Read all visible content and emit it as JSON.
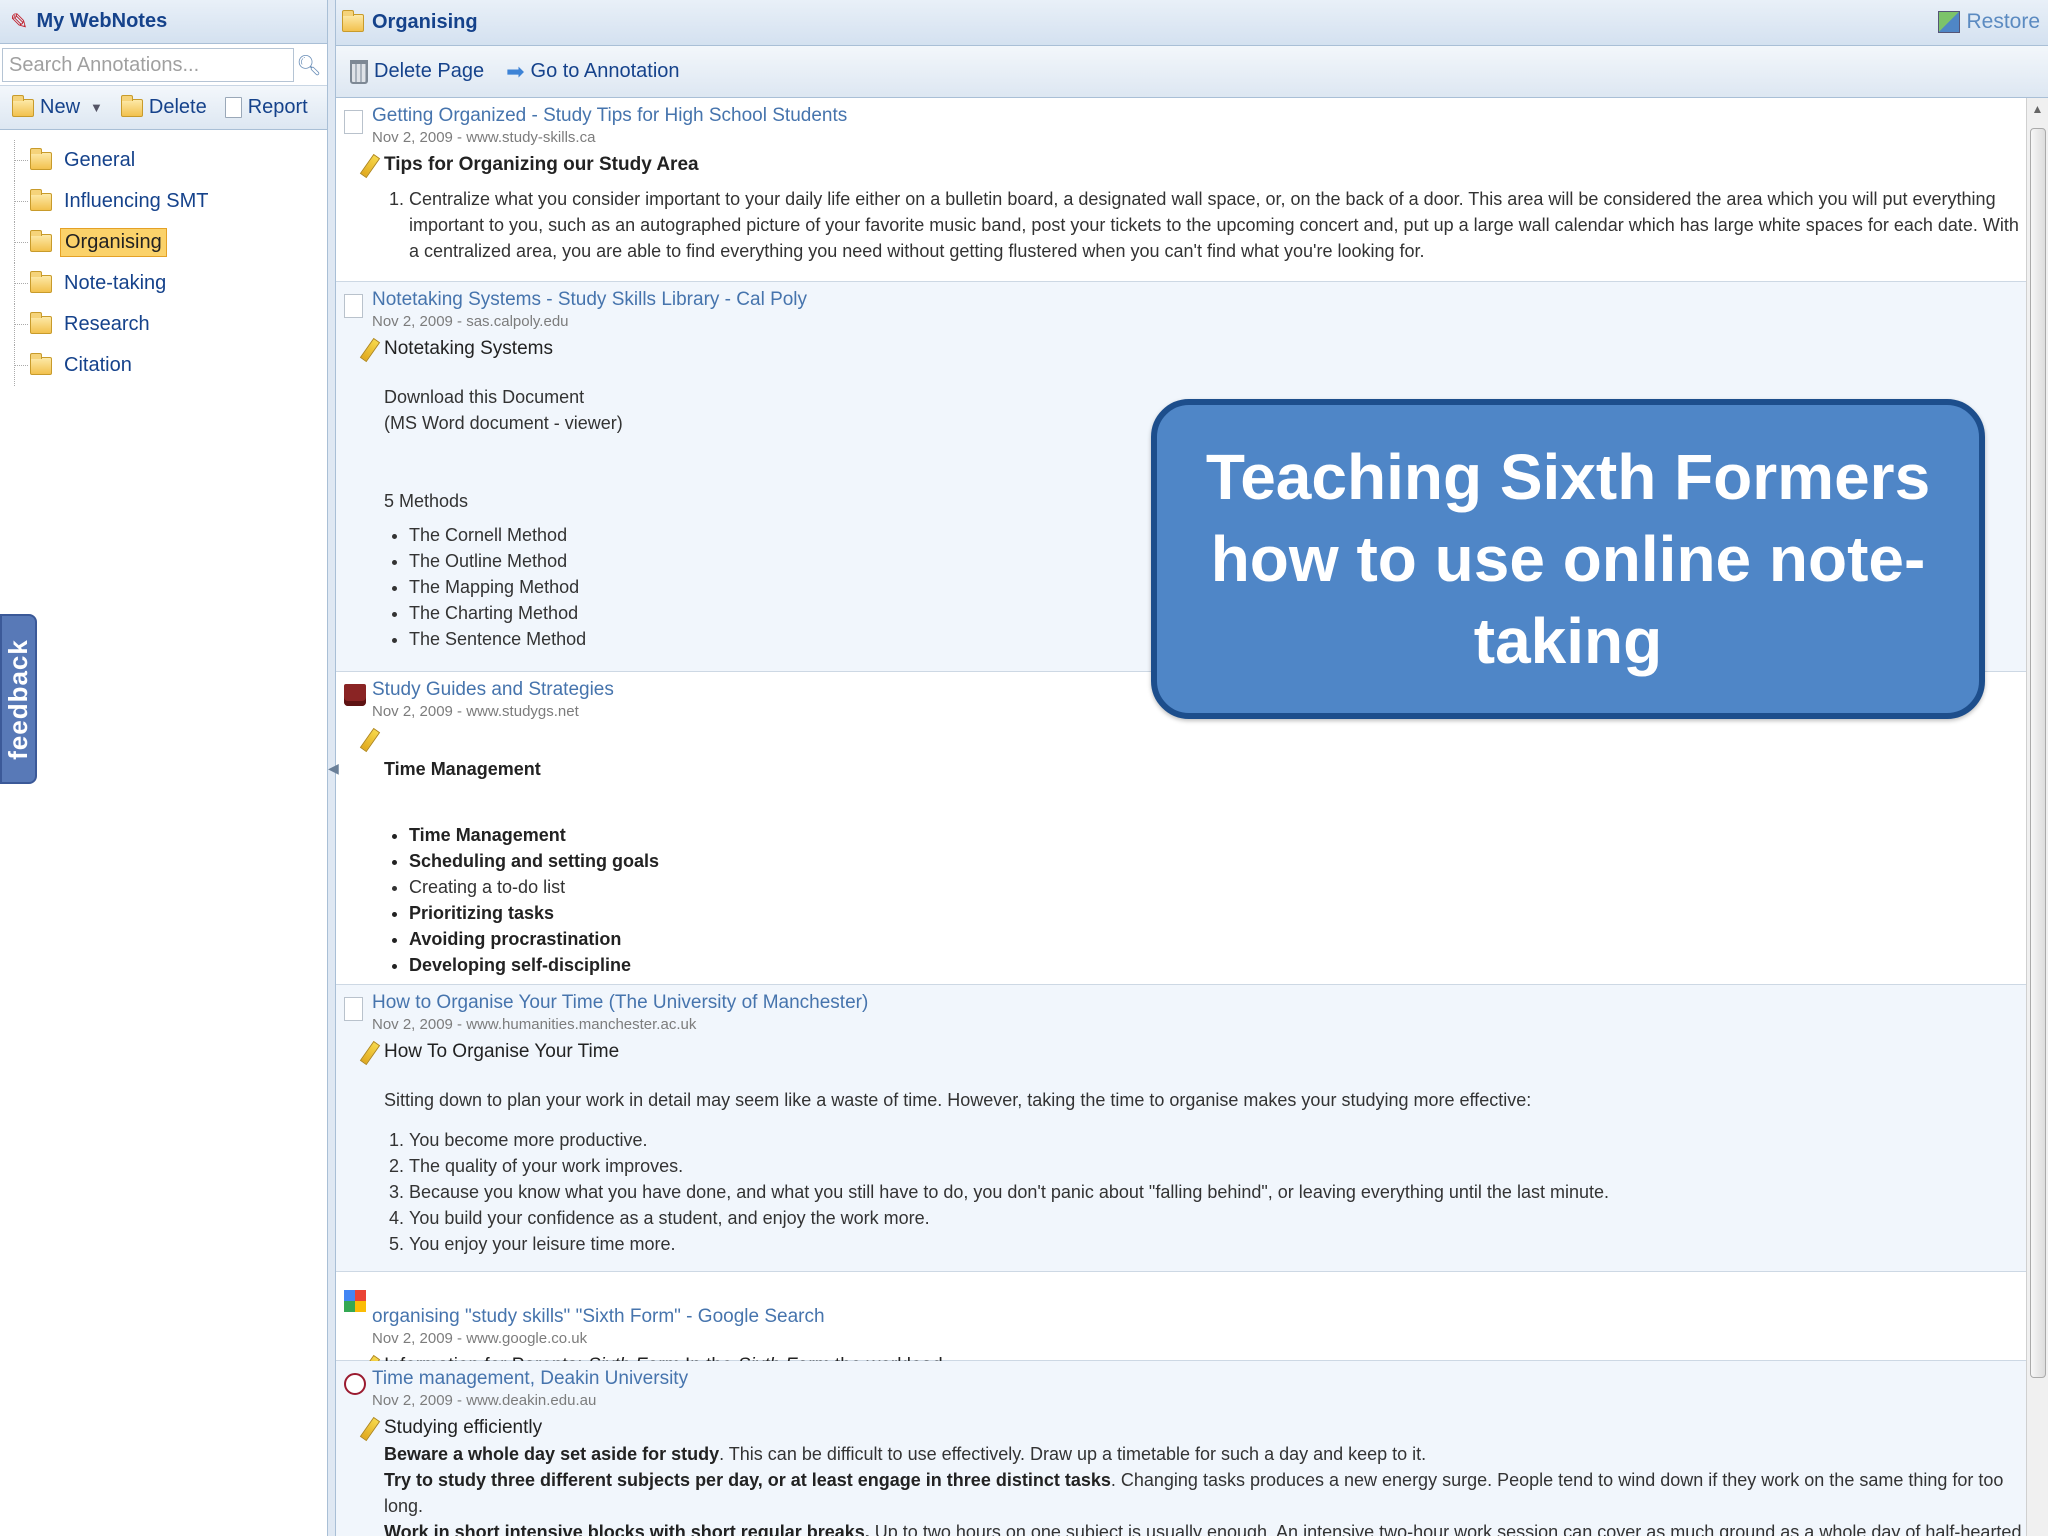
{
  "app": {
    "title": "My WebNotes",
    "search_placeholder": "Search Annotations...",
    "toolbar": {
      "new_label": "New",
      "delete_label": "Delete",
      "report_label": "Report"
    },
    "folders": [
      {
        "label": "General"
      },
      {
        "label": "Influencing SMT"
      },
      {
        "label": "Organising"
      },
      {
        "label": "Note-taking"
      },
      {
        "label": "Research"
      },
      {
        "label": "Citation"
      }
    ],
    "selected_folder": "Organising",
    "feedback_label": "feedback"
  },
  "main": {
    "folder_title": "Organising",
    "restore_label": "Restore",
    "toolbar": {
      "delete_page_label": "Delete Page",
      "go_to_annotation_label": "Go to Annotation"
    }
  },
  "entries": [
    {
      "title": "Getting Organized - Study Tips for High School Students",
      "meta": "Nov 2, 2009 - www.study-skills.ca",
      "annotation": "Tips for Organizing our Study Area",
      "ordered": [
        "Centralize what you consider important to your daily life either on a bulletin board, a designated wall space, or, on the back of a door.  This area will be considered the area which you will put everything important to you, such as an autographed picture of your favorite music band, post your tickets to the upcoming concert and, put up a large wall calendar which has large white spaces for each date.  With a centralized area, you are able to find everything you need without getting flustered when you can't find what you're looking for."
      ]
    },
    {
      "title": "Notetaking Systems - Study Skills Library - Cal Poly",
      "meta": "Nov 2, 2009 - sas.calpoly.edu",
      "annotation": "Notetaking Systems",
      "line1": "Download this Document",
      "line2": "(MS Word document - viewer)",
      "methods_heading": "5 Methods",
      "methods": [
        "The Cornell Method",
        "The Outline Method",
        "The Mapping Method",
        "The Charting Method",
        "The Sentence Method"
      ]
    },
    {
      "title": "Study Guides and Strategies",
      "meta": "Nov 2, 2009 - www.studygs.net",
      "heading": "Time Management",
      "items": [
        "Time Management",
        "Scheduling and setting goals",
        "Creating a to-do list",
        "Prioritizing tasks",
        "Avoiding procrastination",
        "Developing self-discipline"
      ]
    },
    {
      "title": "How to Organise Your Time (The University of Manchester)",
      "meta": "Nov 2, 2009 - www.humanities.manchester.ac.uk",
      "annotation": "How To Organise Your Time",
      "intro": "Sitting down to plan your work in detail may seem like a waste of time. However, taking the time to organise makes your studying more effective:",
      "ordered": [
        "You become more productive.",
        "The quality of your work improves.",
        "Because you know what you have done, and what you still have to do, you don't panic about \"falling behind\", or leaving everything until the last minute.",
        "You build your confidence as a student, and enjoy the work more.",
        "You enjoy your leisure time more."
      ]
    },
    {
      "title": "organising \"study skills\" \"Sixth Form\" - Google Search",
      "meta": "Nov 2, 2009 - www.google.co.uk",
      "annotation_a": "Information for Parents: ",
      "annotation_b": "Sixth Form",
      "annotation_c": " In the ",
      "annotation_d": "Sixth Form",
      "annotation_e": " the workload ..."
    },
    {
      "title": "Time management, Deakin University",
      "meta": "Nov 2, 2009 - www.deakin.edu.au",
      "annotation": "Studying efficiently",
      "p1_bold": "Beware a whole day set aside for study",
      "p1_rest": ". This can be difficult to use effectively. Draw up a timetable for such a day and keep to it.",
      "p2_bold": "Try to study three different subjects per day, or at least engage in three distinct tasks",
      "p2_rest": ". Changing tasks produces a new energy surge. People tend to wind down if they work on the same thing for too long.",
      "p3_bold": "Work in short intensive blocks with short regular breaks.",
      "p3_rest": " Up to two hours on one subject is usually enough. An intensive two-hour work session can cover as much ground as a whole day of half-hearted shuffling about."
    }
  ],
  "callout": {
    "text": "Teaching Sixth Formers how to use online note-taking"
  },
  "colors": {
    "accent": "#15428b",
    "callout_fill": "#4f86c7",
    "callout_border": "#1d4e8c",
    "selected_folder": "#fbd26a"
  }
}
